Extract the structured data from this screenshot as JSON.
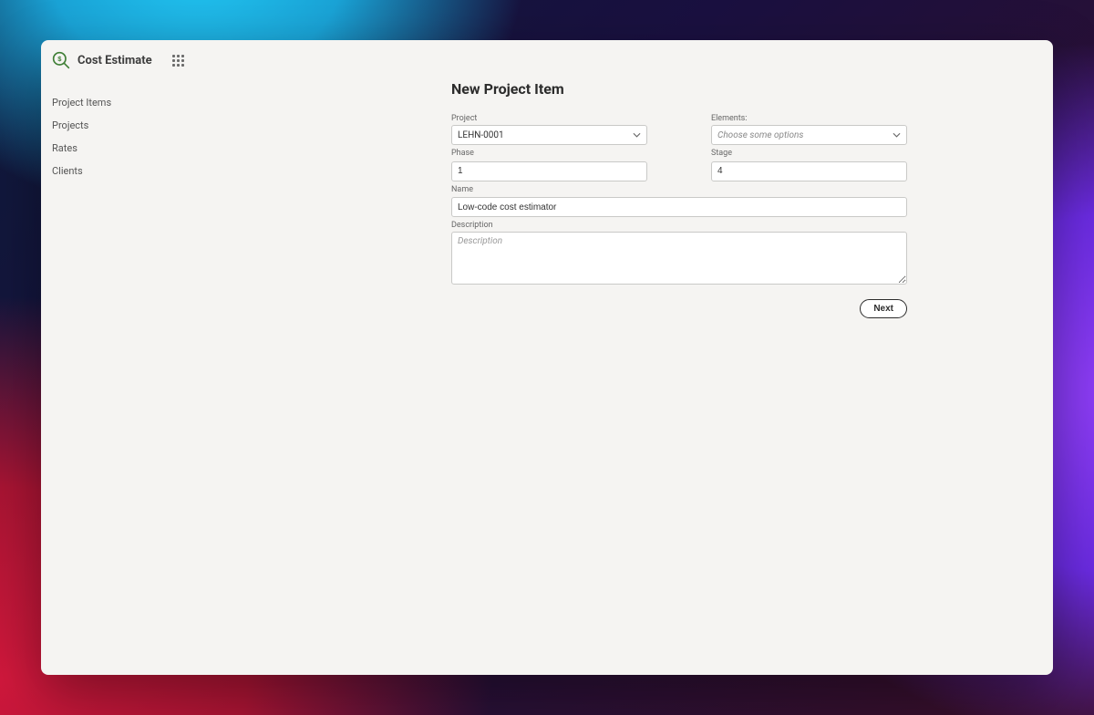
{
  "header": {
    "app_title": "Cost Estimate"
  },
  "sidebar": {
    "items": [
      {
        "label": "Project Items"
      },
      {
        "label": "Projects"
      },
      {
        "label": "Rates"
      },
      {
        "label": "Clients"
      }
    ]
  },
  "form": {
    "title": "New Project Item",
    "project_label": "Project",
    "project_value": "LEHN-0001",
    "elements_label": "Elements:",
    "elements_placeholder": "Choose some options",
    "phase_label": "Phase",
    "phase_value": "1",
    "stage_label": "Stage",
    "stage_value": "4",
    "name_label": "Name",
    "name_value": "Low-code cost estimator",
    "description_label": "Description",
    "description_placeholder": "Description",
    "description_value": "",
    "next_label": "Next"
  },
  "colors": {
    "accent": "#4a8a3f"
  }
}
